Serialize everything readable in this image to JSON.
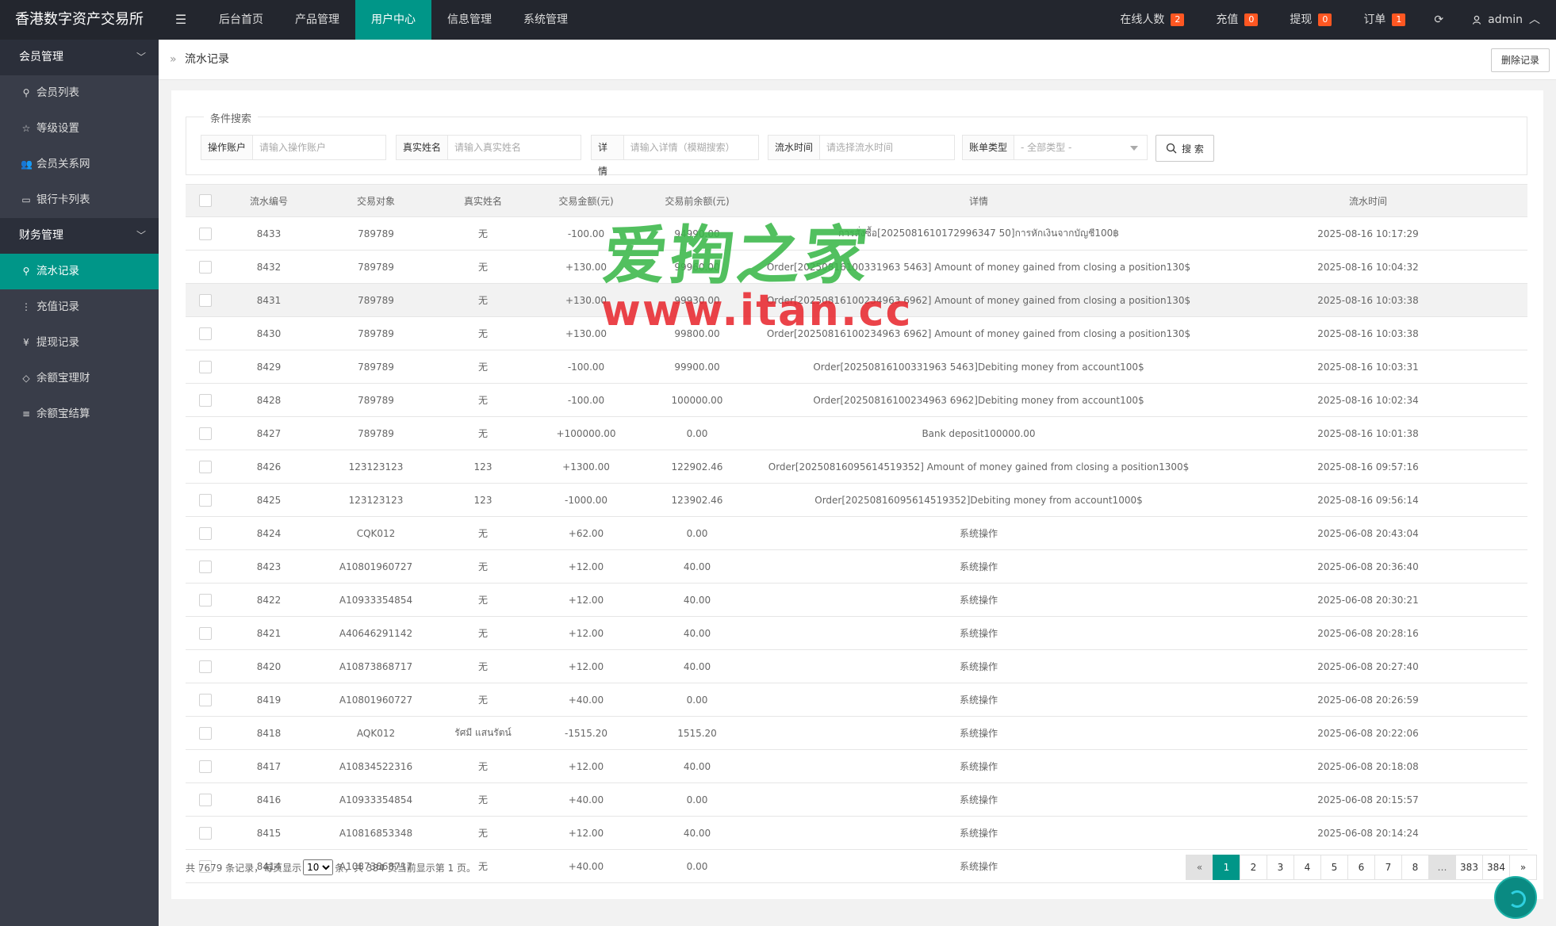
{
  "app": {
    "title": "香港数字资产交易所"
  },
  "nav": {
    "items": [
      "后台首页",
      "产品管理",
      "用户中心",
      "信息管理",
      "系统管理"
    ],
    "active": 2
  },
  "right_nav": {
    "online": {
      "label": "在线人数",
      "count": "2"
    },
    "recharge": {
      "label": "充值",
      "count": "0"
    },
    "withdraw": {
      "label": "提现",
      "count": "0"
    },
    "orders": {
      "label": "订单",
      "count": "1"
    },
    "user": "admin"
  },
  "sidebar": {
    "groups": [
      {
        "label": "会员管理",
        "items": [
          {
            "label": "会员列表",
            "icon": "user-icon"
          },
          {
            "label": "等级设置",
            "icon": "star-icon"
          },
          {
            "label": "会员关系网",
            "icon": "users-icon"
          },
          {
            "label": "银行卡列表",
            "icon": "card-icon"
          }
        ]
      },
      {
        "label": "财务管理",
        "items": [
          {
            "label": "流水记录",
            "icon": "user-icon",
            "active": true
          },
          {
            "label": "充值记录",
            "icon": "dots-icon"
          },
          {
            "label": "提现记录",
            "icon": "yen-icon"
          },
          {
            "label": "余额宝理财",
            "icon": "diamond-icon"
          },
          {
            "label": "余额宝结算",
            "icon": "list-icon"
          }
        ]
      }
    ]
  },
  "breadcrumb": {
    "current": "流水记录"
  },
  "toolbar": {
    "delete_label": "删除记录"
  },
  "search": {
    "legend": "条件搜索",
    "account": {
      "label": "操作账户",
      "placeholder": "请输入操作账户"
    },
    "realname": {
      "label": "真实姓名",
      "placeholder": "请输入真实姓名"
    },
    "detail": {
      "label": "详情",
      "placeholder": "请输入详情（模糊搜索）"
    },
    "time": {
      "label": "流水时间",
      "placeholder": "请选择流水时间"
    },
    "type": {
      "label": "账单类型",
      "value": "- 全部类型 -"
    },
    "button": "搜 索"
  },
  "table": {
    "columns": [
      "流水编号",
      "交易对象",
      "真实姓名",
      "交易金额(元)",
      "交易前余额(元)",
      "详情",
      "流水时间"
    ],
    "rows": [
      [
        "8433",
        "789789",
        "无",
        "-100.00",
        "94990.00",
        "การสั่งซื้อ[2025081610172996347 50]การหักเงินจากบัญชี100฿",
        "2025-08-16 10:17:29"
      ],
      [
        "8432",
        "789789",
        "无",
        "+130.00",
        "99960.00",
        "Order[20250816100331963 5463] Amount of money gained from closing a position130$",
        "2025-08-16 10:04:32"
      ],
      [
        "8431",
        "789789",
        "无",
        "+130.00",
        "99930.00",
        "Order[20250816100234963 6962] Amount of money gained from closing a position130$",
        "2025-08-16 10:03:38"
      ],
      [
        "8430",
        "789789",
        "无",
        "+130.00",
        "99800.00",
        "Order[20250816100234963 6962] Amount of money gained from closing a position130$",
        "2025-08-16 10:03:38"
      ],
      [
        "8429",
        "789789",
        "无",
        "-100.00",
        "99900.00",
        "Order[20250816100331963 5463]Debiting money from account100$",
        "2025-08-16 10:03:31"
      ],
      [
        "8428",
        "789789",
        "无",
        "-100.00",
        "100000.00",
        "Order[20250816100234963 6962]Debiting money from account100$",
        "2025-08-16 10:02:34"
      ],
      [
        "8427",
        "789789",
        "无",
        "+100000.00",
        "0.00",
        "Bank deposit100000.00",
        "2025-08-16 10:01:38"
      ],
      [
        "8426",
        "123123123",
        "123",
        "+1300.00",
        "122902.46",
        "Order[20250816095614519352] Amount of money gained from closing a position1300$",
        "2025-08-16 09:57:16"
      ],
      [
        "8425",
        "123123123",
        "123",
        "-1000.00",
        "123902.46",
        "Order[20250816095614519352]Debiting money from account1000$",
        "2025-08-16 09:56:14"
      ],
      [
        "8424",
        "CQK012",
        "无",
        "+62.00",
        "0.00",
        "系统操作",
        "2025-06-08 20:43:04"
      ],
      [
        "8423",
        "A10801960727",
        "无",
        "+12.00",
        "40.00",
        "系统操作",
        "2025-06-08 20:36:40"
      ],
      [
        "8422",
        "A10933354854",
        "无",
        "+12.00",
        "40.00",
        "系统操作",
        "2025-06-08 20:30:21"
      ],
      [
        "8421",
        "A40646291142",
        "无",
        "+12.00",
        "40.00",
        "系统操作",
        "2025-06-08 20:28:16"
      ],
      [
        "8420",
        "A10873868717",
        "无",
        "+12.00",
        "40.00",
        "系统操作",
        "2025-06-08 20:27:40"
      ],
      [
        "8419",
        "A10801960727",
        "无",
        "+40.00",
        "0.00",
        "系统操作",
        "2025-06-08 20:26:59"
      ],
      [
        "8418",
        "AQK012",
        "รัศมี แสนรัตน์",
        "-1515.20",
        "1515.20",
        "系统操作",
        "2025-06-08 20:22:06"
      ],
      [
        "8417",
        "A10834522316",
        "无",
        "+12.00",
        "40.00",
        "系统操作",
        "2025-06-08 20:18:08"
      ],
      [
        "8416",
        "A10933354854",
        "无",
        "+40.00",
        "0.00",
        "系统操作",
        "2025-06-08 20:15:57"
      ],
      [
        "8415",
        "A10816853348",
        "无",
        "+12.00",
        "40.00",
        "系统操作",
        "2025-06-08 20:14:24"
      ],
      [
        "8414",
        "A10873868717",
        "无",
        "+40.00",
        "0.00",
        "系统操作",
        "2025-06-08 20:13:34"
      ]
    ]
  },
  "pagination": {
    "summary_prefix": "共 7679 条记录，每页显示",
    "page_size": "10",
    "summary_suffix": "条，共 384 页当前显示第 1 页。",
    "pages": [
      "«",
      "1",
      "2",
      "3",
      "4",
      "5",
      "6",
      "7",
      "8",
      "…",
      "383",
      "384",
      "»"
    ],
    "current": "1"
  },
  "watermark": {
    "line1": "爱掏之家",
    "line2": "www.itan.cc"
  },
  "colors": {
    "accent": "#009688",
    "header": "#23262e",
    "sidebar": "#393d49",
    "negative": "#ff3b30",
    "positive": "#10a010",
    "badge": "#ff5722"
  }
}
